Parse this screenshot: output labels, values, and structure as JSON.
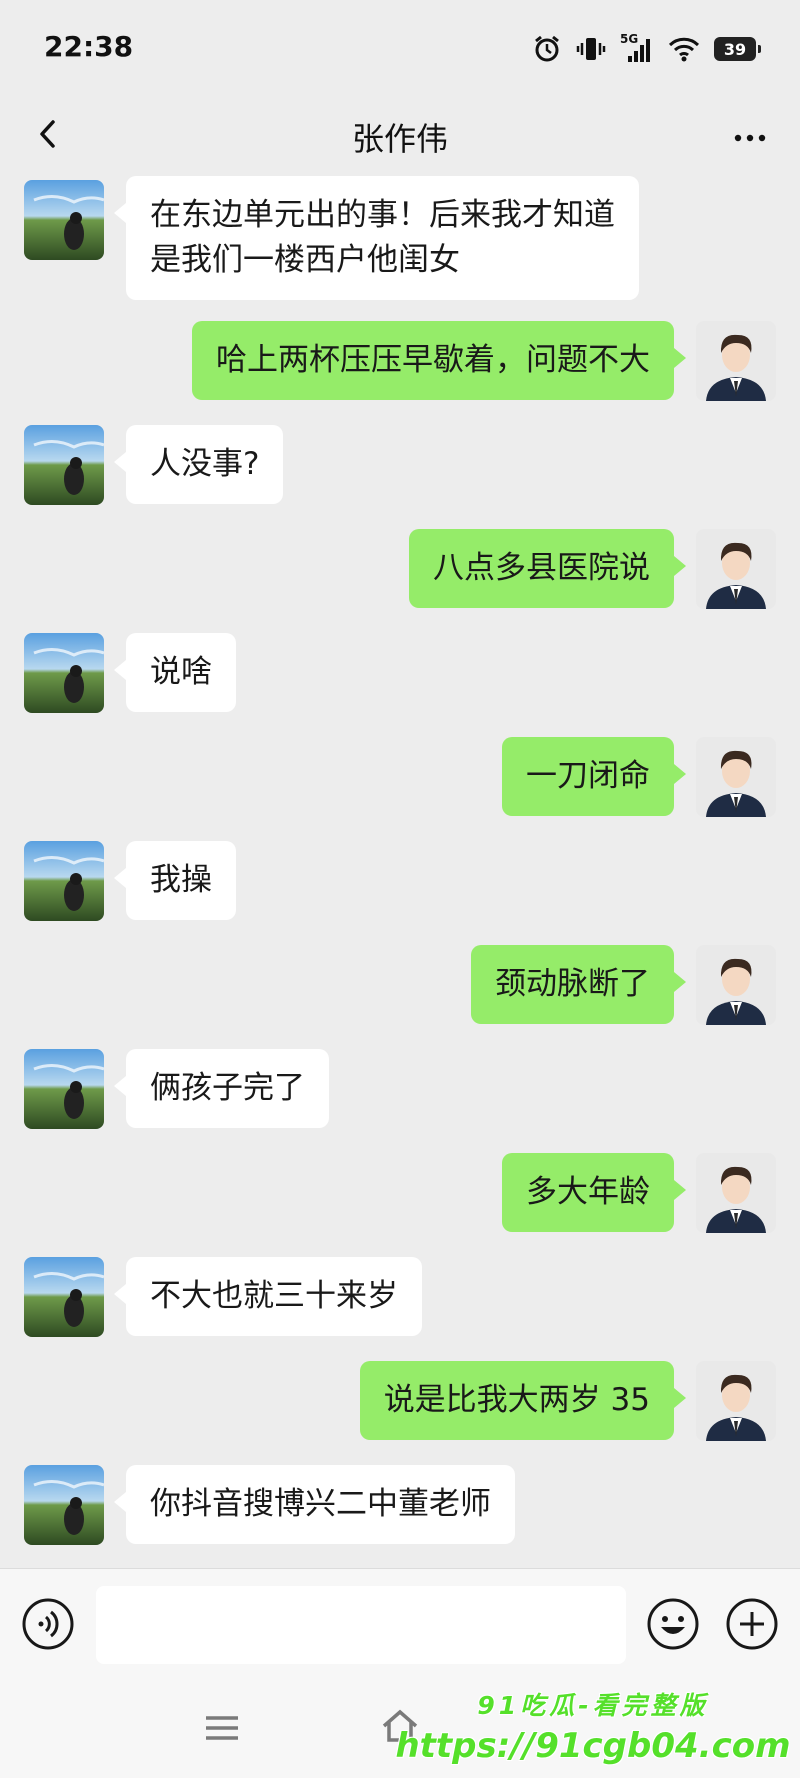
{
  "status_bar": {
    "time": "22:38",
    "network": "5G",
    "battery": "39",
    "icons": [
      "alarm-icon",
      "vibrate-icon",
      "signal-icon",
      "wifi-icon",
      "battery-icon"
    ]
  },
  "nav": {
    "title": "张作伟",
    "icons": [
      "back-chevron-icon",
      "more-dots-icon"
    ]
  },
  "messages": [
    {
      "sender": "them",
      "lines": [
        "在东边单元出的事！后来我才知道",
        "是我们一楼西户他闺女"
      ]
    },
    {
      "sender": "me",
      "lines": [
        "哈上两杯压压早歇着，问题不大"
      ]
    },
    {
      "sender": "them",
      "lines": [
        "人没事?"
      ]
    },
    {
      "sender": "me",
      "lines": [
        "八点多县医院说"
      ]
    },
    {
      "sender": "them",
      "lines": [
        "说啥"
      ]
    },
    {
      "sender": "me",
      "lines": [
        "一刀闭命"
      ]
    },
    {
      "sender": "them",
      "lines": [
        "我操"
      ]
    },
    {
      "sender": "me",
      "lines": [
        "颈动脉断了"
      ]
    },
    {
      "sender": "them",
      "lines": [
        "俩孩子完了"
      ]
    },
    {
      "sender": "me",
      "lines": [
        "多大年龄"
      ]
    },
    {
      "sender": "them",
      "lines": [
        "不大也就三十来岁"
      ]
    },
    {
      "sender": "me",
      "lines": [
        "说是比我大两岁 35"
      ]
    },
    {
      "sender": "them",
      "lines": [
        "你抖音搜博兴二中董老师"
      ]
    }
  ],
  "input_bar": {
    "icons": [
      "voice-icon",
      "emoji-icon",
      "plus-icon"
    ]
  },
  "system_nav": {
    "icons": [
      "menu-icon",
      "home-icon"
    ]
  },
  "watermark": {
    "line1": "91吃瓜-看完整版",
    "line2": "https://91cgb04.com"
  },
  "colors": {
    "background": "#ededed",
    "my_bubble": "#95ec69",
    "their_bubble": "#ffffff",
    "watermark": "#55e02a"
  }
}
